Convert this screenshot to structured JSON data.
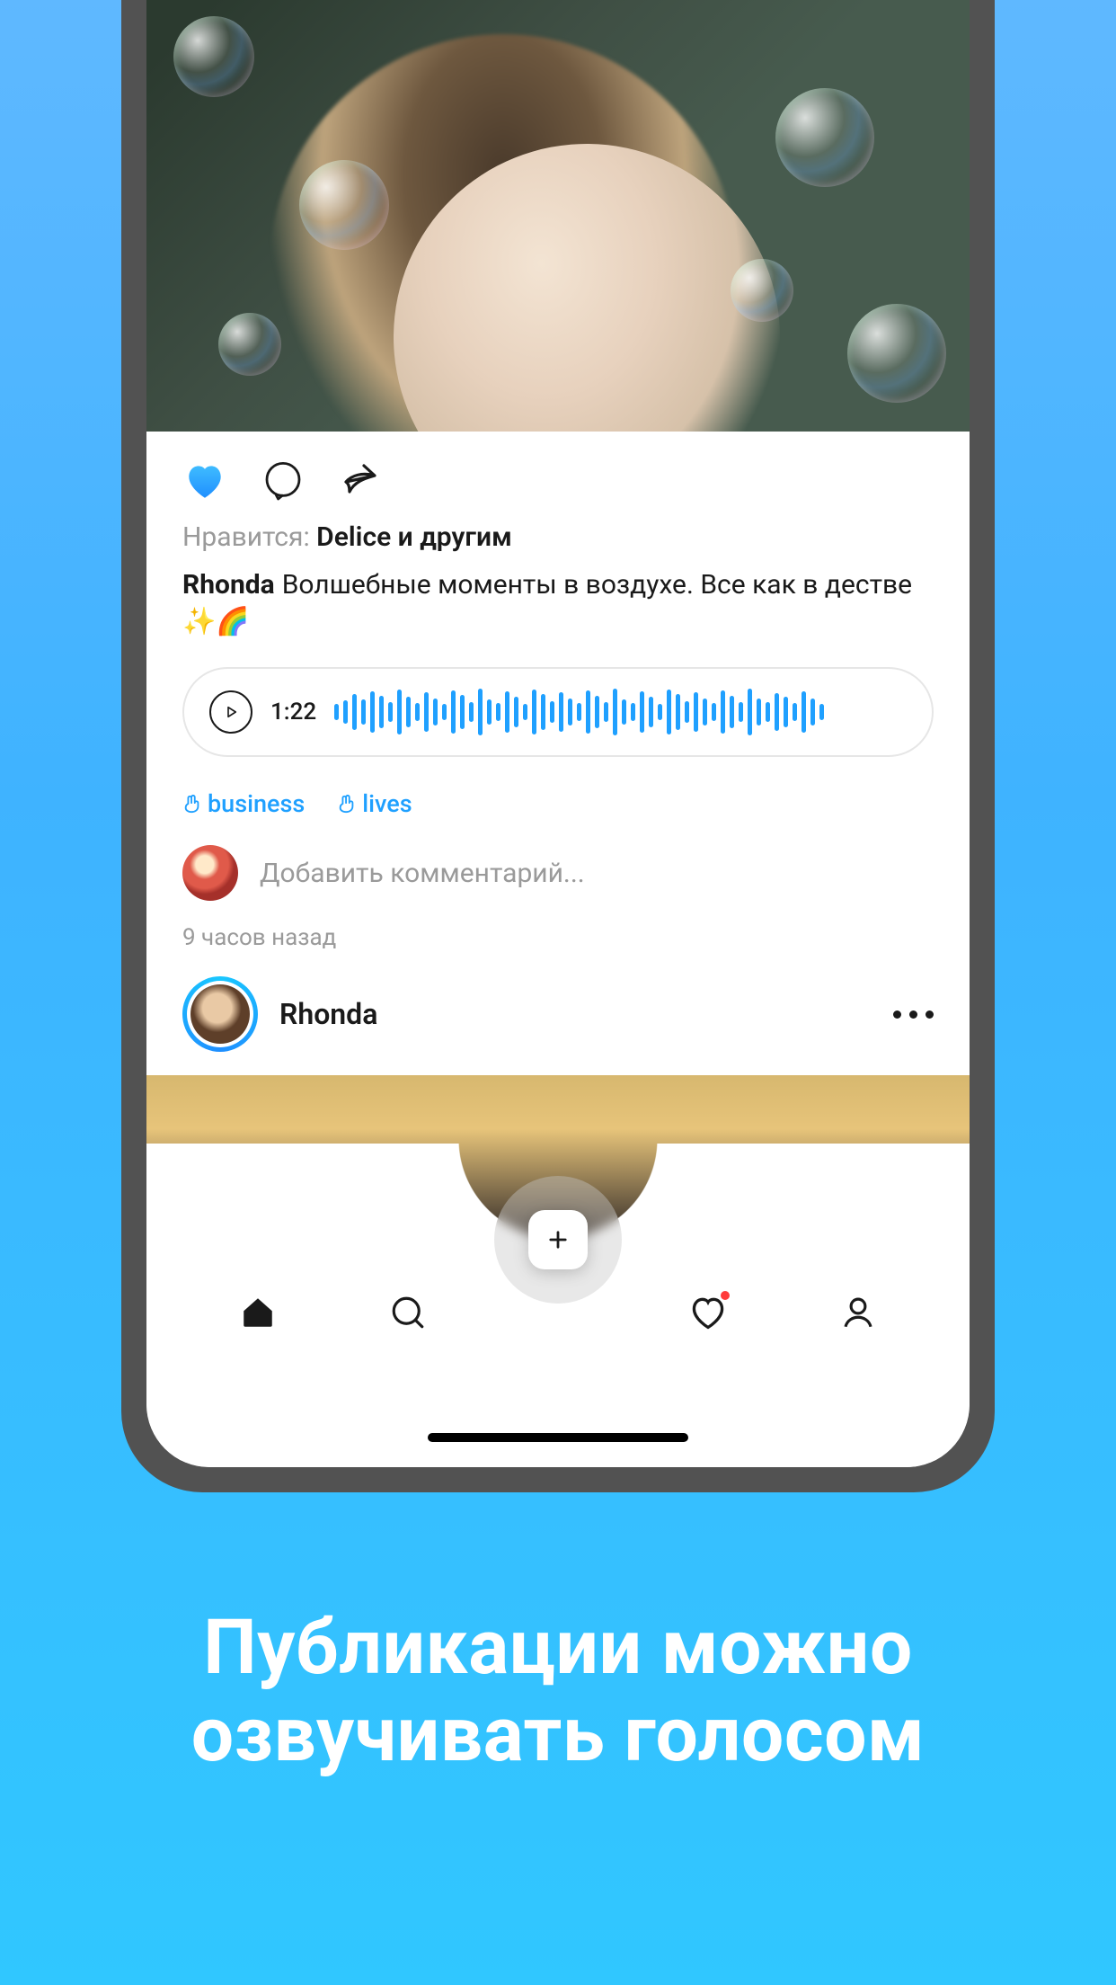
{
  "post": {
    "likes_label": "Нравится: ",
    "likes_bold": "Delice и другим",
    "author": "Rhonda",
    "caption_text": "Волшебные моменты в воздухе. Все как в дестве ",
    "caption_emoji": "✨🌈",
    "voice_duration": "1:22",
    "tags": [
      "business",
      "lives"
    ],
    "comment_placeholder": "Добавить комментарий...",
    "timestamp": "9 часов назад"
  },
  "next_post": {
    "author": "Rhonda"
  },
  "nav": {
    "items": [
      "home",
      "search",
      "",
      "heart",
      "profile"
    ]
  },
  "marketing": {
    "line1": "Публикации можно",
    "line2": "озвучивать голосом"
  }
}
